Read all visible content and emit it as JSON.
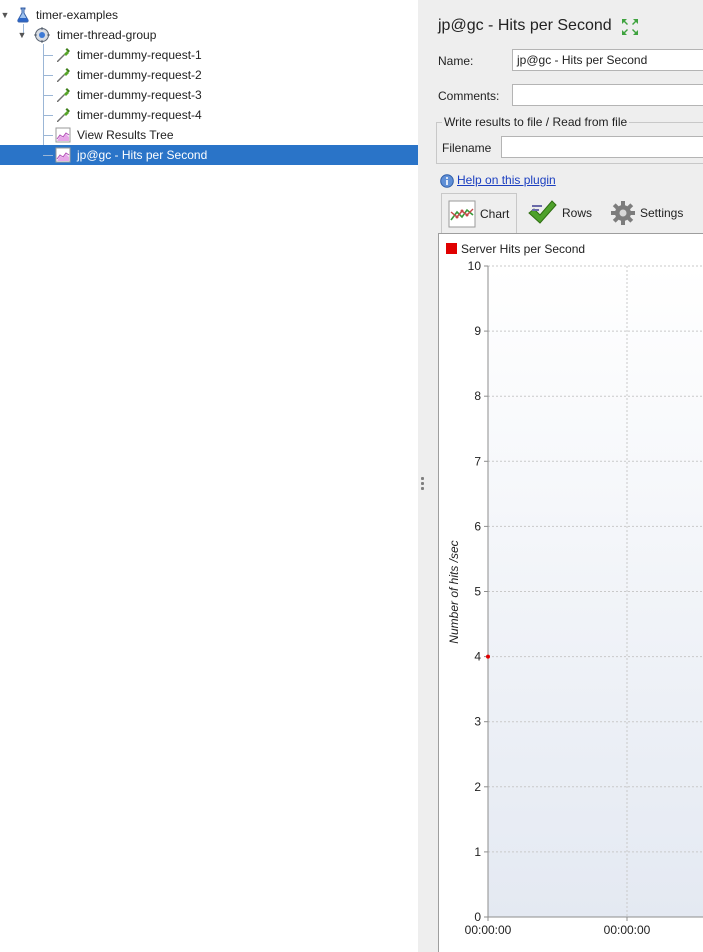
{
  "tree": {
    "items": [
      {
        "label": "timer-examples",
        "icon": "test-plan-flask-icon"
      },
      {
        "label": "timer-thread-group",
        "icon": "thread-group-gear-icon"
      },
      {
        "label": "timer-dummy-request-1",
        "icon": "sampler-pipette-icon"
      },
      {
        "label": "timer-dummy-request-2",
        "icon": "sampler-pipette-icon"
      },
      {
        "label": "timer-dummy-request-3",
        "icon": "sampler-pipette-icon"
      },
      {
        "label": "timer-dummy-request-4",
        "icon": "sampler-pipette-icon"
      },
      {
        "label": "View Results Tree",
        "icon": "listener-chart-icon"
      },
      {
        "label": "jp@gc - Hits per Second",
        "icon": "listener-chart-icon",
        "selected": true
      }
    ]
  },
  "panel": {
    "title": "jp@gc - Hits per Second",
    "name_label": "Name:",
    "name_value": "jp@gc - Hits per Second",
    "comments_label": "Comments:",
    "comments_value": "",
    "file_group_label": "Write results to file / Read from file",
    "filename_label": "Filename",
    "filename_value": "",
    "help_link": "Help on this plugin"
  },
  "tabs": [
    {
      "label": "Chart",
      "icon": "chart-line-icon",
      "active": true
    },
    {
      "label": "Rows",
      "icon": "checkmark-icon",
      "active": false
    },
    {
      "label": "Settings",
      "icon": "gear-icon",
      "active": false
    }
  ],
  "colors": {
    "selection": "#2a74c8",
    "series_red": "#e00000",
    "link": "#1a3ec0"
  },
  "chart_data": {
    "type": "line",
    "title": "",
    "xlabel": "",
    "ylabel": "Number of hits /sec",
    "ylim": [
      0,
      10
    ],
    "y_ticks": [
      "0",
      "1",
      "2",
      "3",
      "4",
      "5",
      "6",
      "7",
      "8",
      "9",
      "10"
    ],
    "x_ticks": [
      "00:00:00",
      "00:00:00"
    ],
    "grid": true,
    "legend_position": "top-left",
    "series": [
      {
        "name": "Server Hits per Second",
        "color": "#e00000",
        "points": [
          {
            "x": "00:00:00",
            "y": 4
          }
        ]
      }
    ]
  }
}
